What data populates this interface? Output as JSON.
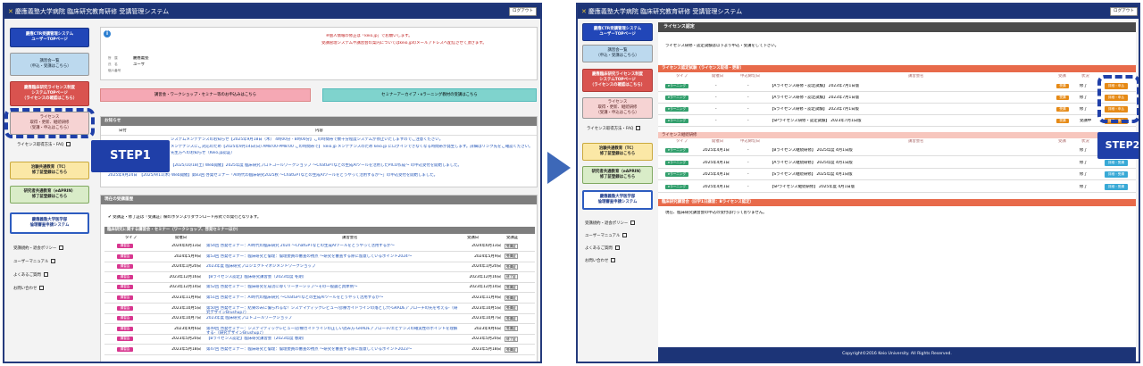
{
  "left": {
    "header_title": "慶應義塾大学病院 臨床研究教育研修 受講管理システム",
    "logout": "ログアウト",
    "sidebar": {
      "ctr_top": [
        "慶應CTR受講管理システム",
        "ユーザーTOPページ"
      ],
      "course_list": [
        "講習会一覧",
        "（申込・受講はこちら）"
      ],
      "license_top": [
        "慶應臨床研究ライセンス制度",
        "システムTOPページ",
        "（ライセンスの確認はこちら）"
      ],
      "license_box": [
        "ライセンス",
        "取得・更新、継続研修",
        "（受講・申込はこちら）"
      ],
      "license_faq": "ライセンス取得方法・FAQ",
      "tc_training": [
        "治験共通教育（TC）",
        "修了証登録はこちら"
      ],
      "aprin": [
        "研究者共通教育（eAPRIN）",
        "修了証登録はこちら"
      ],
      "ethics": [
        "慶應義塾大学医学部",
        "倫理審査申請システム"
      ],
      "links": [
        "受講規約・退会ポリシー",
        "ユーザーマニュアル",
        "よくあるご質問",
        "お問い合わせ"
      ]
    },
    "notice_line1": "※個人情報の修正は「keio.jp」でお願いします。",
    "notice_line2": "受講管理システムや講習会の案内についてはkeio.jpのメールアドレスへ配信させて頂きます。",
    "user_labels": [
      "所　属",
      "氏　名",
      "個人番号"
    ],
    "user_values": [
      "慶應義塾",
      "ユーザ"
    ],
    "btn_workshop": "講習会・ワークショップ・セミナー等のお申込みはこちら",
    "btn_archive": "セミナーアーカイブ・eラーニング教材の受講はこちら",
    "news_title": "お知らせ",
    "news_cols": [
      "日付",
      "内容"
    ],
    "news_rows": [
      "システムメンテナンスのお知らせ【2025年9月18日（木） 4時00分 - 8時00分】この時間帯で数十分程度システムが停止いたしますのでご注意ください。",
      "メンテナンスにご対応のため【2025年9月14日(日) AM8:00-PM8:00 この時間帯で】 keio.jp メンテナンスのため keio.jp にログインできなくなる時間帯が発生します。詳細はリンク先をご確認ください。",
      "先生方へのお知らせ（Keio.jp認証）",
      "【2025/10/18(土) Web開催】2025年度 臨床研究プロトコールワークショップ 〜ChatGPTなどの生成AIツールを活用したPICO作成〜 の申込受付を開始しました。",
      "2025年9月24日　【2025/9/11(木) Web開催】第83回 啓発セミナー「AI時代の臨床研究2025秋 〜ChatGPTなどの生成AIツールをどうやって活用するか〜」の申込受付を開始しました。"
    ],
    "cert_title": "現在の受講履歴",
    "cert_note": "受講証・修了証は『受講証』欄のボタンよりダウンロード形式での発行となります。",
    "seminar_title": "臨床研究に関する講習会・セミナー（ワークショップ、啓発セミナーほか）",
    "seminar_cols": [
      "タイプ",
      "開催日",
      "講習会名",
      "受講日",
      "受講証"
    ],
    "seminar_rows": [
      {
        "type": "講習会",
        "date": "2024年6月13日",
        "name": "第54回 啓発セミナー：AI時代の臨床研究 2024 〜ChatGPTなどの生成AIツールをどうやって活用するか〜",
        "taken": "2024年6月13日",
        "cert": "受講証"
      },
      {
        "type": "講習会",
        "date": "2024年5月9日",
        "name": "第53回 啓発セミナー：臨床研究と倫理：倫理委員の審査の視点 〜研究を審査する際に留意しているポイント2024〜",
        "taken": "2024年5月9日",
        "cert": "受講証"
      },
      {
        "type": "講習会",
        "date": "2024年1月20日",
        "name": "2023年度 臨床研究プロジェクトマネジメントワークショップ",
        "taken": "2024年1月20日",
        "cert": "受講証"
      },
      {
        "type": "講習会",
        "date": "2023年12月16日",
        "name": "【Bライセンス認定】臨床研究講習会（2023年度 冬期）",
        "taken": "2023年12月16日",
        "cert": "修了証"
      },
      {
        "type": "講習会",
        "date": "2023年12月14日",
        "name": "第52回 啓発セミナー：臨床研究を成功に導くリーダーシップ〜その一般論と具体例〜",
        "taken": "2023年12月14日",
        "cert": "受講証"
      },
      {
        "type": "講習会",
        "date": "2023年11月9日",
        "name": "第51回 啓発セミナー：AI時代の臨床研究 〜ChatGPTなどの生成AIツールをどうやって活用するか〜",
        "taken": "2023年11月9日",
        "cert": "受講証"
      },
      {
        "type": "講習会",
        "date": "2023年10月5日",
        "name": "第50回 啓発セミナー：結果のみに偏られるな！システマティックレビュー/診療ガイドラインの落とし穴-GRADEアプローチの先を考える-（研究デザインBrushup♪）",
        "taken": "2023年10月5日",
        "cert": "受講証"
      },
      {
        "type": "講習会",
        "date": "2023年10月7日",
        "name": "2023年度 臨床研究プロトコールワークショップ",
        "taken": "2023年10月7日",
        "cert": "受講証"
      },
      {
        "type": "講習会",
        "date": "2023年9月6日",
        "name": "第49回 啓発セミナー：システマティックレビュー/診療ガイドラインの正しい読み方-GRADEアプローチ/エビデンスの確実性のポイントを理解する-（研究デザインBrushup♪）",
        "taken": "2023年9月6日",
        "cert": "受講証"
      },
      {
        "type": "講習会",
        "date": "2023年5月20日",
        "name": "【Bライセンス認定】臨床研究講習会（2023年度 春期）",
        "taken": "2023年5月20日",
        "cert": "修了証"
      },
      {
        "type": "講習会",
        "date": "2023年5月18日",
        "name": "第47回 啓発セミナー：臨床研究と倫理：倫理委員の審査の視点 〜研究を審査する際に留意しているポイント2023〜",
        "taken": "2023年5月18日",
        "cert": "受講証"
      }
    ],
    "step1": "STEP1"
  },
  "right": {
    "header_title": "慶應義塾大学病院 臨床研究教育研修 受講管理システム",
    "logout": "ログアウト",
    "sidebar": {
      "ctr_top": [
        "慶應CTR受講管理システム",
        "ユーザーTOPページ"
      ],
      "course_list": [
        "講習会一覧",
        "（申込・受講はこちら）"
      ],
      "license_top": [
        "慶應臨床研究ライセンス制度",
        "システムTOPページ",
        "（ライセンスの確認はこちら）"
      ],
      "license_box": [
        "ライセンス",
        "取得・更新、継続研修",
        "（受講・申込はこちら）"
      ],
      "license_faq": "ライセンス取得方法・FAQ",
      "tc_training": [
        "治験共通教育（TC）",
        "修了証登録はこちら"
      ],
      "aprin": [
        "研究者共通教育（eAPRIN）",
        "修了証登録はこちら"
      ],
      "ethics": [
        "慶應義塾大学医学部",
        "倫理審査申請システム"
      ],
      "links": [
        "受講規約・退会ポリシー",
        "ユーザーマニュアル",
        "よくあるご質問",
        "お問い合わせ"
      ]
    },
    "page_title": "ライセンス認定",
    "intro": "ライセンス研修・認定試験は以下より申込・受講をして下さい。",
    "exam_title": "ライセンス認定試験（ライセンス取得・更新）",
    "exam_cols": [
      "タイプ",
      "開催日",
      "申込締切日",
      "講習会名",
      "受講",
      "状況"
    ],
    "exam_rows": [
      {
        "type": "eラーニング",
        "date": "-",
        "deadline": "-",
        "name": "【Aライセンス研修・認定試験】 2023年7月1日版",
        "take": "受講",
        "status": "修了",
        "btn": "詳細・申込"
      },
      {
        "type": "eラーニング",
        "date": "-",
        "deadline": "-",
        "name": "【Aライセンス研修・認定試験】 2023年7月1日版",
        "take": "受講",
        "status": "修了",
        "btn": "詳細・申込"
      },
      {
        "type": "eラーニング",
        "date": "-",
        "deadline": "-",
        "name": "【Sライセンス研修・認定試験】 2023年7月1日版",
        "take": "受講",
        "status": "修了",
        "btn": "詳細・申込"
      },
      {
        "type": "eラーニング",
        "date": "-",
        "deadline": "-",
        "name": "【SPライセンス研修・認定試験】 2023年7月1日版",
        "take": "受講",
        "status": "受講中",
        "btn": "詳細・申込"
      }
    ],
    "cont_title": "ライセンス継続研修",
    "cont_cols": [
      "タイプ",
      "開催日",
      "申込締切日",
      "講習会名",
      "受講",
      "状況"
    ],
    "cont_rows": [
      {
        "type": "eラーニング",
        "date": "2025年4月1日",
        "deadline": "-",
        "name": "【Bライセンス継続研修】 2025年度 4月1日版",
        "status": "修了",
        "btn": "詳細・受講"
      },
      {
        "type": "eラーニング",
        "date": "2025年4月1日",
        "deadline": "-",
        "name": "【Aライセンス継続研修】 2025年度 4月1日版",
        "status": "修了",
        "btn": "詳細・受講"
      },
      {
        "type": "eラーニング",
        "date": "2025年4月1日",
        "deadline": "-",
        "name": "【Sライセンス継続研修】 2025年度 4月1日版",
        "status": "修了",
        "btn": "詳細・受講"
      },
      {
        "type": "eラーニング",
        "date": "2025年4月1日",
        "deadline": "-",
        "name": "【SPライセンス継続研修】 2025年度 4月1日版",
        "status": "修了",
        "btn": "詳細・受講"
      }
    ],
    "clinical_title": "臨床研究講習会（旧学1日講習：Bライセンス認定）",
    "clinical_note": "現在、臨床研究講習会の申込の受付は行っておりません。",
    "footer": "Copyright©2016 Keio University. All Rights Reserved.",
    "step2": "STEP2"
  }
}
